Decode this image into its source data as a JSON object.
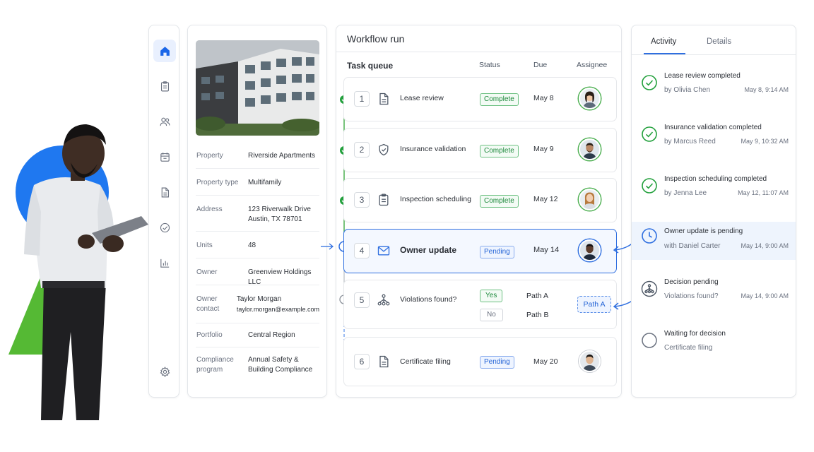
{
  "sidebar": {
    "items": [
      {
        "icon": "home-icon",
        "active": true
      },
      {
        "icon": "clipboard-icon"
      },
      {
        "icon": "users-icon"
      },
      {
        "icon": "calendar-icon"
      },
      {
        "icon": "document-icon"
      },
      {
        "icon": "check-circle-icon"
      },
      {
        "icon": "bar-chart-icon"
      },
      {
        "icon": "settings-gear-icon"
      }
    ]
  },
  "property": {
    "rows": [
      {
        "label": "Property",
        "value": "Riverside Apartments"
      },
      {
        "label": "Property type",
        "value": "Multifamily"
      },
      {
        "label": "Address",
        "value": "123 Riverwalk Drive",
        "value2": "Austin, TX 78701"
      },
      {
        "label": "Units",
        "value": "48"
      },
      {
        "label": "Owner",
        "value": "Greenview Holdings LLC"
      },
      {
        "label": "Owner contact",
        "value": "Taylor Morgan",
        "value2": "taylor.morgan@example.com"
      },
      {
        "label": "Portfolio",
        "value": "Central Region"
      },
      {
        "label": "Compliance",
        "label2": "program",
        "value": "Annual Safety &",
        "value2": "Building Compliance"
      }
    ]
  },
  "workflow": {
    "title": "Workflow run",
    "queue_label": "Task queue",
    "columns": {
      "status": "Status",
      "due": "Due",
      "assignee": "Assignee"
    },
    "tasks": [
      {
        "num": "1",
        "name": "Lease review",
        "icon": "document-icon",
        "status": "Complete",
        "due": "May 8"
      },
      {
        "num": "2",
        "name": "Insurance validation",
        "icon": "shield-icon",
        "status": "Complete",
        "due": "May 9"
      },
      {
        "num": "3",
        "name": "Inspection scheduling",
        "icon": "clipboard-icon",
        "status": "Complete",
        "due": "May 12"
      },
      {
        "num": "4",
        "name": "Owner update",
        "icon": "mail-icon",
        "status": "Pending",
        "due": "May 14"
      },
      {
        "num": "5",
        "name": "Violations found?",
        "icon": "decision-tree-icon",
        "yes": "Yes",
        "no": "No",
        "path_a": "Path A",
        "path_b": "Path B",
        "selected_path": "Path A"
      },
      {
        "num": "6",
        "name": "Certificate filing",
        "icon": "document-icon",
        "status": "Pending",
        "due": "May 20"
      }
    ]
  },
  "activity": {
    "tabs": [
      "Activity",
      "Details"
    ],
    "events": [
      {
        "title": "Lease review completed",
        "sub": "by Olivia Chen",
        "date": "May 8, 9:14 AM",
        "icon": "check-circle-icon"
      },
      {
        "title": "Insurance validation completed",
        "sub": "by Marcus Reed",
        "date": "May 9, 10:32 AM",
        "icon": "check-circle-icon"
      },
      {
        "title": "Inspection scheduling completed",
        "sub": "by Jenna Lee",
        "date": "May 12, 11:07 AM",
        "icon": "check-circle-icon"
      },
      {
        "title": "Owner update is pending",
        "sub": "with Daniel Carter",
        "date": "May 14, 9:00 AM",
        "icon": "clock-icon"
      },
      {
        "title": "Decision pending",
        "sub": "Violations found?",
        "date": "May 14, 9:00 AM",
        "icon": "decision-tree-icon"
      },
      {
        "title": "Waiting for decision",
        "sub": "Certificate filing",
        "date": "",
        "icon": "empty-circle-icon"
      }
    ]
  },
  "colors": {
    "accent": "#2f6fe0",
    "complete": "#1e8a3c",
    "deco_blue": "#1a73e8",
    "deco_green": "#4cb82f"
  }
}
